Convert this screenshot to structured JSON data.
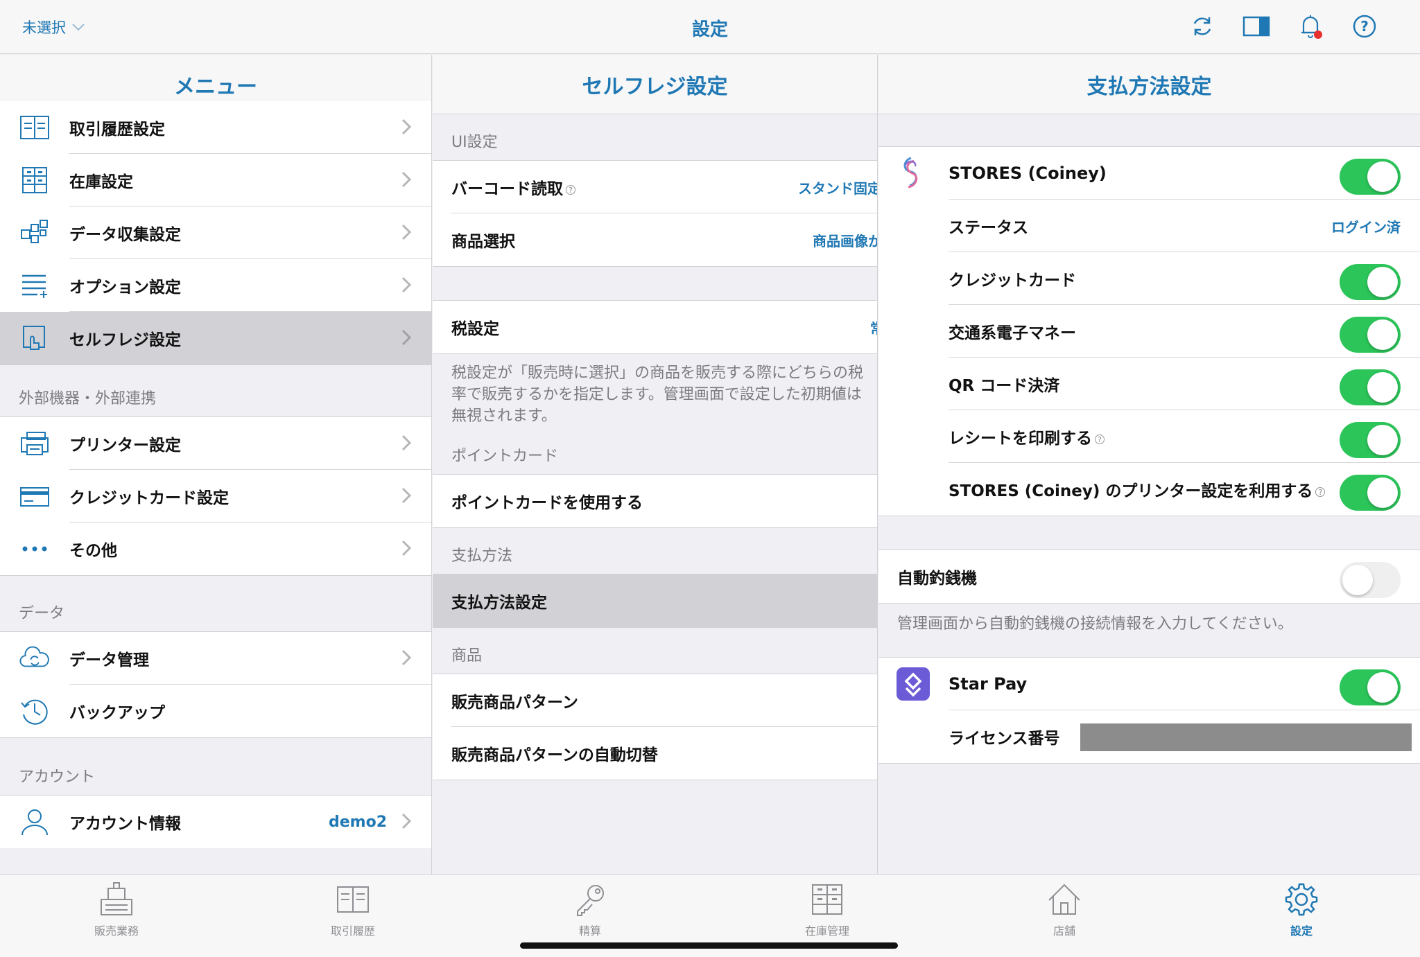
{
  "topbar": {
    "unselected": "未選択",
    "title": "設定",
    "icons": [
      "sync-icon",
      "split-view-icon",
      "bell-icon",
      "help-icon"
    ]
  },
  "menu": {
    "title": "メニュー",
    "items_top": [
      {
        "label": "取引履歴設定",
        "icon": "receipt-list-icon"
      },
      {
        "label": "在庫設定",
        "icon": "inventory-icon"
      },
      {
        "label": "データ収集設定",
        "icon": "data-collect-icon"
      },
      {
        "label": "オプション設定",
        "icon": "option-list-icon"
      },
      {
        "label": "セルフレジ設定",
        "icon": "self-register-icon"
      }
    ],
    "section_external": "外部機器・外部連携",
    "items_external": [
      {
        "label": "プリンター設定",
        "icon": "printer-icon"
      },
      {
        "label": "クレジットカード設定",
        "icon": "credit-card-icon"
      },
      {
        "label": "その他",
        "icon": "more-icon"
      }
    ],
    "section_data": "データ",
    "items_data": [
      {
        "label": "データ管理",
        "icon": "cloud-sync-icon"
      },
      {
        "label": "バックアップ",
        "icon": "history-icon"
      }
    ],
    "section_account": "アカウント",
    "account": {
      "label": "アカウント情報",
      "value": "demo2",
      "icon": "user-icon"
    }
  },
  "selfreg": {
    "title": "セルフレジ設定",
    "section_ui": "UI設定",
    "barcode": {
      "label": "バーコード読取",
      "value": "スタンド固定"
    },
    "product_select": {
      "label": "商品選択",
      "value": "商品画像から"
    },
    "tax": {
      "label": "税設定",
      "value": "常"
    },
    "tax_desc": [
      "税設定が「販売時に選択」の商品を販売する際にどちらの税",
      "率で販売するかを指定します。管理画面で設定した初期値は",
      "無視されます。"
    ],
    "section_point": "ポイントカード",
    "point_use": "ポイントカードを使用する",
    "section_payment": "支払方法",
    "payment_settings": "支払方法設定",
    "section_product": "商品",
    "pattern": "販売商品パターン",
    "pattern_auto": "販売商品パターンの自動切替"
  },
  "payment": {
    "title": "支払方法設定",
    "stores": {
      "name": "STORES (Coiney)",
      "status_label": "ステータス",
      "status_value": "ログイン済",
      "credit": "クレジットカード",
      "transit": "交通系電子マネー",
      "qr": "QR コード決済",
      "receipt": "レシートを印刷する",
      "printer": "STORES (Coiney) のプリンター設定を利用する",
      "toggles": {
        "main": true,
        "credit": true,
        "transit": true,
        "qr": true,
        "receipt": true,
        "printer": true
      }
    },
    "changer": {
      "label": "自動釣銭機",
      "enabled": false,
      "desc": "管理画面から自動釣銭機の接続情報を入力してください。"
    },
    "starpay": {
      "name": "Star Pay",
      "enabled": true,
      "license_label": "ライセンス番号"
    }
  },
  "tabs": [
    {
      "label": "販売業務",
      "icon": "register-icon",
      "active": false
    },
    {
      "label": "取引履歴",
      "icon": "receipt-book-icon",
      "active": false
    },
    {
      "label": "精算",
      "icon": "key-icon",
      "active": false
    },
    {
      "label": "在庫管理",
      "icon": "inventory-cabinet-icon",
      "active": false
    },
    {
      "label": "店舗",
      "icon": "home-icon",
      "active": false
    },
    {
      "label": "設定",
      "icon": "gear-icon",
      "active": true
    }
  ],
  "colors": {
    "accent": "#1f78b4",
    "toggle_on": "#2cc55a",
    "selected_row": "#d1d1d6",
    "badge": "#e8302f"
  }
}
